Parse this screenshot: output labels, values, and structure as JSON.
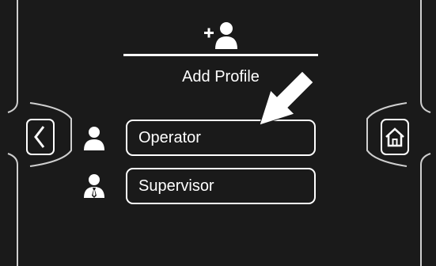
{
  "header": {
    "icon": "add-user-icon",
    "label": "Add Profile"
  },
  "nav": {
    "back_icon": "chevron-left-icon",
    "home_icon": "home-icon"
  },
  "profiles": [
    {
      "label": "Operator",
      "icon": "user-icon"
    },
    {
      "label": "Supervisor",
      "icon": "user-tie-icon"
    }
  ],
  "colors": {
    "background": "#1a1a1a",
    "foreground": "#ffffff"
  }
}
